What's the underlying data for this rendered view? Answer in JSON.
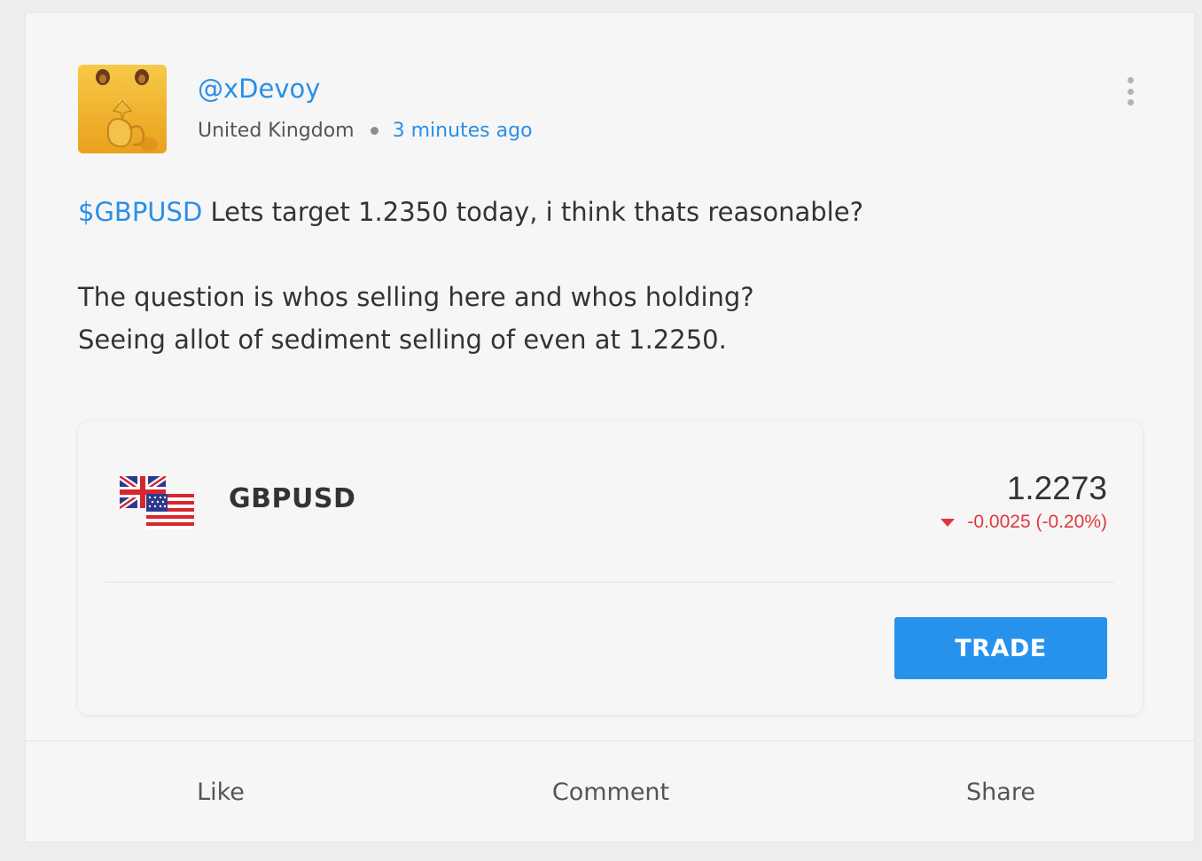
{
  "post": {
    "username": "@xDevoy",
    "location": "United Kingdom",
    "time_ago": "3 minutes ago",
    "ticker_tag": "$GBPUSD",
    "line1_rest": " Lets target 1.2350 today, i think thats reasonable?",
    "line2": "The question is whos selling here and whos holding?",
    "line3": "Seeing allot of sediment selling of even at 1.2250."
  },
  "instrument": {
    "name": "GBPUSD",
    "price": "1.2273",
    "change": "-0.0025 (-0.20%)",
    "direction": "down",
    "change_color": "#e0383e",
    "trade_label": "TRADE"
  },
  "actions": {
    "like": "Like",
    "comment": "Comment",
    "share": "Share"
  },
  "colors": {
    "accent": "#2a8fe8",
    "trade_button": "#2792ec"
  },
  "icons": {
    "menu": "more-vertical-icon",
    "avatar": "yellow-character-avatar",
    "flags": "uk-us-flags-icon"
  }
}
